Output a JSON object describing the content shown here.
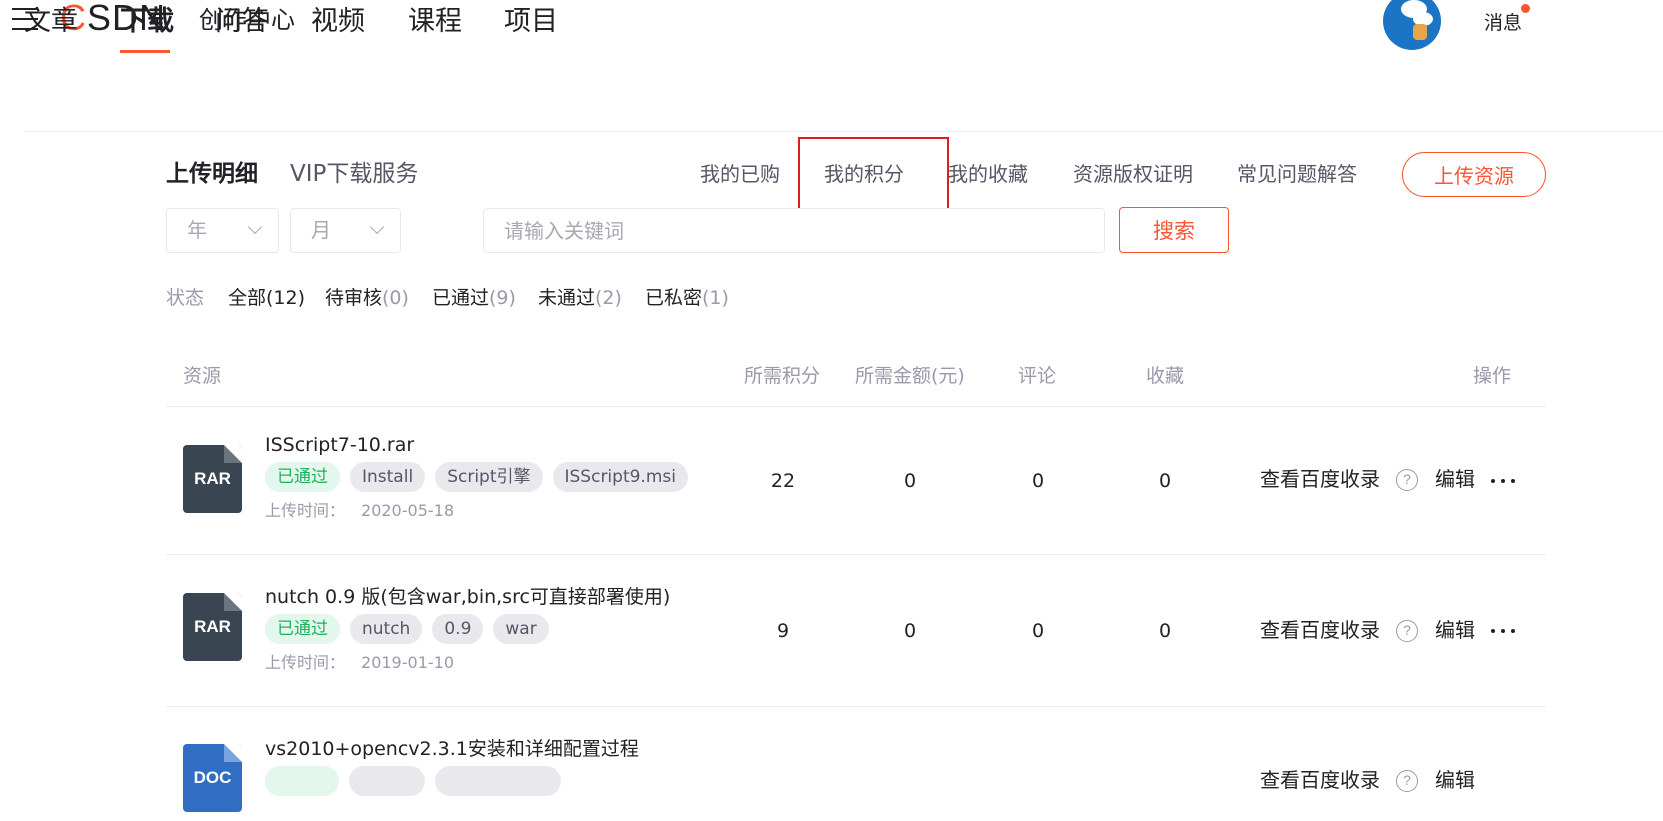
{
  "header": {
    "logo_c": "C",
    "logo_rest": "SDN",
    "subtitle": "创作中心",
    "messages_label": "消息"
  },
  "main_tabs": [
    "文章",
    "下载",
    "问答",
    "视频",
    "课程",
    "项目"
  ],
  "main_tabs_active": "下载",
  "subnav": {
    "left": [
      "上传明细",
      "VIP下载服务"
    ],
    "right": [
      "我的已购",
      "我的积分",
      "我的收藏",
      "资源版权证明",
      "常见问题解答"
    ],
    "upload_button": "上传资源"
  },
  "filters": {
    "year_placeholder": "年",
    "month_placeholder": "月",
    "search_placeholder": "请输入关键词",
    "search_button": "搜索"
  },
  "status": {
    "label": "状态",
    "items": [
      {
        "label": "全部",
        "count": "(12)"
      },
      {
        "label": "待审核",
        "count": "(0)"
      },
      {
        "label": "已通过",
        "count": "(9)"
      },
      {
        "label": "未通过",
        "count": "(2)"
      },
      {
        "label": "已私密",
        "count": "(1)"
      }
    ]
  },
  "table": {
    "headers": [
      "资源",
      "所需积分",
      "所需金额(元)",
      "评论",
      "收藏",
      "操作"
    ],
    "rows": [
      {
        "ext": "RAR",
        "title": "ISScript7-10.rar",
        "status_tag": "已通过",
        "tags": [
          "Install",
          "Script引擎",
          "ISScript9.msi"
        ],
        "upload_label": "上传时间：",
        "upload_date": "2020-05-18",
        "points": "22",
        "price": "0",
        "comments": "0",
        "favorites": "0",
        "action_baidu": "查看百度收录",
        "action_edit": "编辑"
      },
      {
        "ext": "RAR",
        "title": "nutch 0.9 版(包含war,bin,src可直接部署使用)",
        "status_tag": "已通过",
        "tags": [
          "nutch",
          "0.9",
          "war"
        ],
        "upload_label": "上传时间：",
        "upload_date": "2019-01-10",
        "points": "9",
        "price": "0",
        "comments": "0",
        "favorites": "0",
        "action_baidu": "查看百度收录",
        "action_edit": "编辑"
      },
      {
        "ext": "DOC",
        "title": "vs2010+opencv2.3.1安装和详细配置过程",
        "action_baidu": "查看百度收录",
        "action_edit": "编辑"
      }
    ]
  },
  "colors": {
    "accent": "#fc5531",
    "highlight_box": "#e01c1c",
    "pass_tag_text": "#1eb25f",
    "pass_tag_bg": "#e3f7ec"
  }
}
